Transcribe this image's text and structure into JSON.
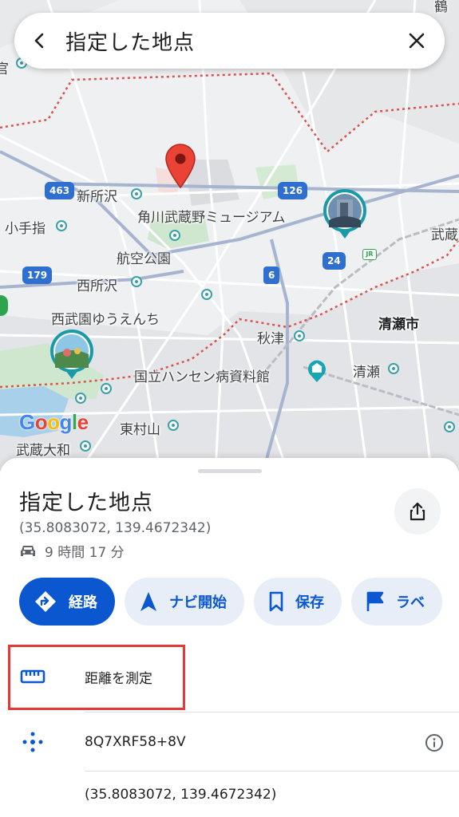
{
  "search": {
    "title": "指定した地点",
    "back_icon": "arrow-back-icon",
    "close_icon": "close-icon"
  },
  "map": {
    "labels": {
      "shinsyozawa": "新所沢",
      "kotesashi": "小手指",
      "kadokawa": "角川武蔵野ミュージアム",
      "kokukoen": "航空公園",
      "nishitokorozawa": "西所沢",
      "seibuen": "西武園ゆうえんち",
      "kiyose_city": "清瀬市",
      "akitsu": "秋津",
      "kiyose": "清瀬",
      "hansen": "国立ハンセン病資料館",
      "higashimurayama": "東村山",
      "musashiyamato": "武蔵大和",
      "musashi_edge": "武蔵",
      "tokugawa_edge": "官",
      "tl_edge": "鶴"
    },
    "road_shields": {
      "r463": "463",
      "r126": "126",
      "r179": "179",
      "r24": "24",
      "r6": "6"
    },
    "logo": [
      "G",
      "o",
      "o",
      "g",
      "l",
      "e"
    ],
    "colors": {
      "pin": "#ea4335",
      "route_shield": "#2f6fd0",
      "boundary": "#d9534f"
    }
  },
  "sheet": {
    "title": "指定した地点",
    "coordinates": "(35.8083072, 139.4672342)",
    "travel_time": "9 時間 17 分",
    "travel_icon": "car-icon",
    "share_icon": "share-icon",
    "chips": [
      {
        "label": "経路",
        "icon": "directions-icon"
      },
      {
        "label": "ナビ開始",
        "icon": "navigation-icon"
      },
      {
        "label": "保存",
        "icon": "bookmark-icon"
      },
      {
        "label": "ラベ",
        "icon": "flag-icon"
      }
    ],
    "measure_label": "距離を測定",
    "measure_icon": "ruler-icon",
    "plus_code": "8Q7XRF58+8V",
    "plus_code_icon": "plus-code-icon",
    "info_icon": "info-icon",
    "coords_row": "(35.8083072, 139.4672342)",
    "accent_color": "#0b57d0",
    "highlight_color": "#e53935"
  }
}
